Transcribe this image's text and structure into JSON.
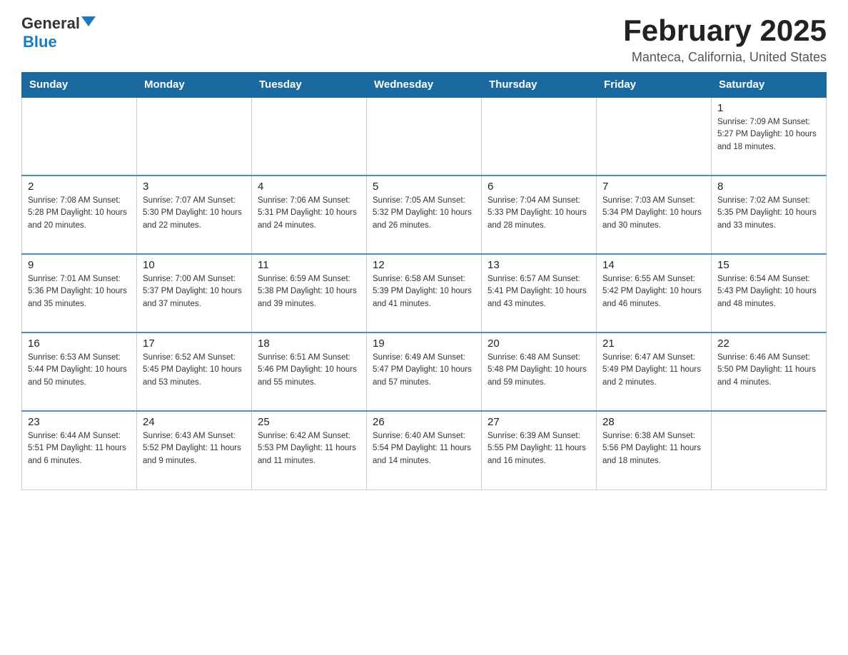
{
  "header": {
    "logo_general": "General",
    "logo_blue": "Blue",
    "main_title": "February 2025",
    "subtitle": "Manteca, California, United States"
  },
  "days_of_week": [
    "Sunday",
    "Monday",
    "Tuesday",
    "Wednesday",
    "Thursday",
    "Friday",
    "Saturday"
  ],
  "weeks": [
    [
      {
        "day": "",
        "info": ""
      },
      {
        "day": "",
        "info": ""
      },
      {
        "day": "",
        "info": ""
      },
      {
        "day": "",
        "info": ""
      },
      {
        "day": "",
        "info": ""
      },
      {
        "day": "",
        "info": ""
      },
      {
        "day": "1",
        "info": "Sunrise: 7:09 AM\nSunset: 5:27 PM\nDaylight: 10 hours and 18 minutes."
      }
    ],
    [
      {
        "day": "2",
        "info": "Sunrise: 7:08 AM\nSunset: 5:28 PM\nDaylight: 10 hours and 20 minutes."
      },
      {
        "day": "3",
        "info": "Sunrise: 7:07 AM\nSunset: 5:30 PM\nDaylight: 10 hours and 22 minutes."
      },
      {
        "day": "4",
        "info": "Sunrise: 7:06 AM\nSunset: 5:31 PM\nDaylight: 10 hours and 24 minutes."
      },
      {
        "day": "5",
        "info": "Sunrise: 7:05 AM\nSunset: 5:32 PM\nDaylight: 10 hours and 26 minutes."
      },
      {
        "day": "6",
        "info": "Sunrise: 7:04 AM\nSunset: 5:33 PM\nDaylight: 10 hours and 28 minutes."
      },
      {
        "day": "7",
        "info": "Sunrise: 7:03 AM\nSunset: 5:34 PM\nDaylight: 10 hours and 30 minutes."
      },
      {
        "day": "8",
        "info": "Sunrise: 7:02 AM\nSunset: 5:35 PM\nDaylight: 10 hours and 33 minutes."
      }
    ],
    [
      {
        "day": "9",
        "info": "Sunrise: 7:01 AM\nSunset: 5:36 PM\nDaylight: 10 hours and 35 minutes."
      },
      {
        "day": "10",
        "info": "Sunrise: 7:00 AM\nSunset: 5:37 PM\nDaylight: 10 hours and 37 minutes."
      },
      {
        "day": "11",
        "info": "Sunrise: 6:59 AM\nSunset: 5:38 PM\nDaylight: 10 hours and 39 minutes."
      },
      {
        "day": "12",
        "info": "Sunrise: 6:58 AM\nSunset: 5:39 PM\nDaylight: 10 hours and 41 minutes."
      },
      {
        "day": "13",
        "info": "Sunrise: 6:57 AM\nSunset: 5:41 PM\nDaylight: 10 hours and 43 minutes."
      },
      {
        "day": "14",
        "info": "Sunrise: 6:55 AM\nSunset: 5:42 PM\nDaylight: 10 hours and 46 minutes."
      },
      {
        "day": "15",
        "info": "Sunrise: 6:54 AM\nSunset: 5:43 PM\nDaylight: 10 hours and 48 minutes."
      }
    ],
    [
      {
        "day": "16",
        "info": "Sunrise: 6:53 AM\nSunset: 5:44 PM\nDaylight: 10 hours and 50 minutes."
      },
      {
        "day": "17",
        "info": "Sunrise: 6:52 AM\nSunset: 5:45 PM\nDaylight: 10 hours and 53 minutes."
      },
      {
        "day": "18",
        "info": "Sunrise: 6:51 AM\nSunset: 5:46 PM\nDaylight: 10 hours and 55 minutes."
      },
      {
        "day": "19",
        "info": "Sunrise: 6:49 AM\nSunset: 5:47 PM\nDaylight: 10 hours and 57 minutes."
      },
      {
        "day": "20",
        "info": "Sunrise: 6:48 AM\nSunset: 5:48 PM\nDaylight: 10 hours and 59 minutes."
      },
      {
        "day": "21",
        "info": "Sunrise: 6:47 AM\nSunset: 5:49 PM\nDaylight: 11 hours and 2 minutes."
      },
      {
        "day": "22",
        "info": "Sunrise: 6:46 AM\nSunset: 5:50 PM\nDaylight: 11 hours and 4 minutes."
      }
    ],
    [
      {
        "day": "23",
        "info": "Sunrise: 6:44 AM\nSunset: 5:51 PM\nDaylight: 11 hours and 6 minutes."
      },
      {
        "day": "24",
        "info": "Sunrise: 6:43 AM\nSunset: 5:52 PM\nDaylight: 11 hours and 9 minutes."
      },
      {
        "day": "25",
        "info": "Sunrise: 6:42 AM\nSunset: 5:53 PM\nDaylight: 11 hours and 11 minutes."
      },
      {
        "day": "26",
        "info": "Sunrise: 6:40 AM\nSunset: 5:54 PM\nDaylight: 11 hours and 14 minutes."
      },
      {
        "day": "27",
        "info": "Sunrise: 6:39 AM\nSunset: 5:55 PM\nDaylight: 11 hours and 16 minutes."
      },
      {
        "day": "28",
        "info": "Sunrise: 6:38 AM\nSunset: 5:56 PM\nDaylight: 11 hours and 18 minutes."
      },
      {
        "day": "",
        "info": ""
      }
    ]
  ]
}
